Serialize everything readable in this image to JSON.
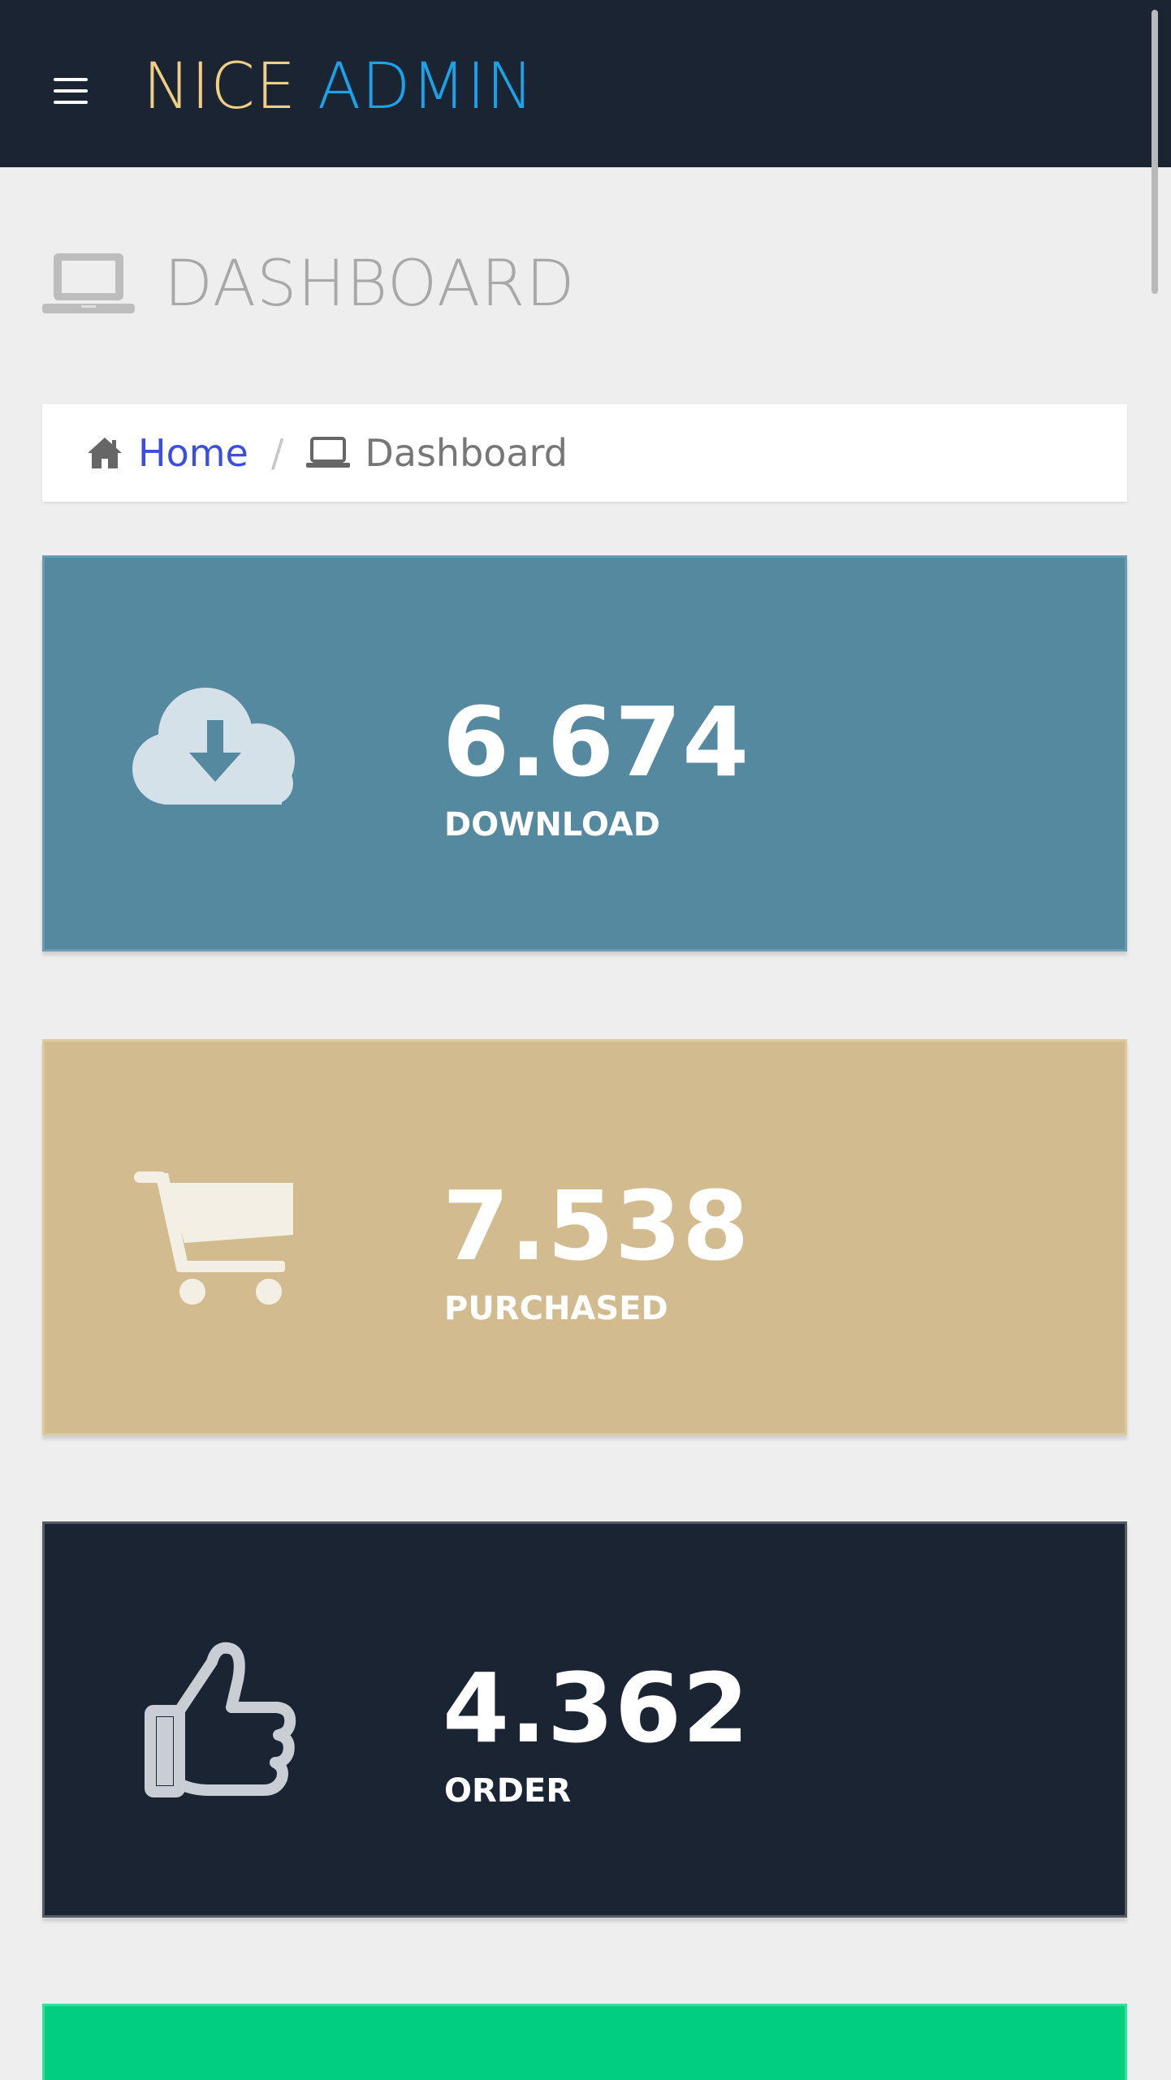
{
  "header": {
    "brand_part1": "NICE",
    "brand_part2": "ADMIN",
    "menu_icon": "hamburger-icon"
  },
  "page": {
    "title": "DASHBOARD",
    "title_icon": "laptop-icon"
  },
  "breadcrumb": {
    "home_label": "Home",
    "separator": "/",
    "current_label": "Dashboard"
  },
  "stats": [
    {
      "value": "6.674",
      "label": "DOWNLOAD",
      "icon": "cloud-download-icon",
      "color": "#55899f"
    },
    {
      "value": "7.538",
      "label": "PURCHASED",
      "icon": "shopping-cart-icon",
      "color": "#d2bc8f"
    },
    {
      "value": "4.362",
      "label": "ORDER",
      "icon": "thumbs-up-icon",
      "color": "#1b2433"
    },
    {
      "value": "",
      "label": "",
      "icon": "",
      "color": "#02ce7f"
    }
  ],
  "colors": {
    "topbar": "#1b2433",
    "brand_yellow": "#f0cf82",
    "brand_blue": "#1aa3e8",
    "link": "#3b4ee0",
    "background": "#eeeeee"
  }
}
